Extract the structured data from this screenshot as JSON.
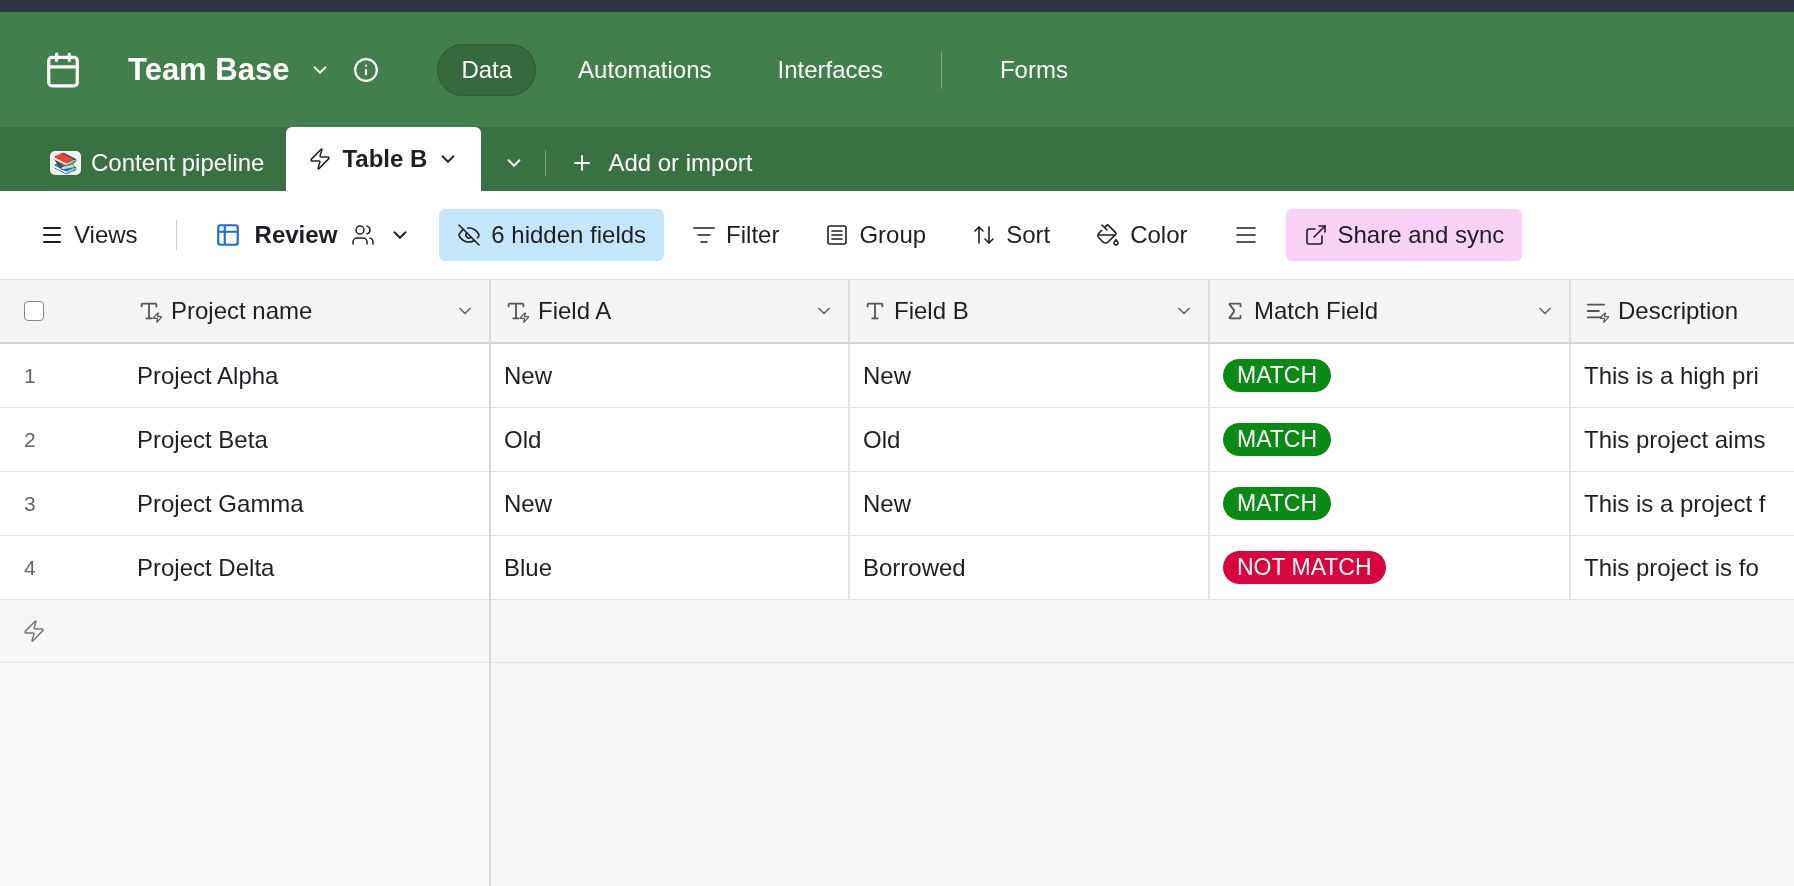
{
  "base": {
    "title": "Team Base",
    "nav": [
      {
        "label": "Data",
        "selected": true
      },
      {
        "label": "Automations",
        "selected": false
      },
      {
        "label": "Interfaces",
        "selected": false
      },
      {
        "label": "Forms",
        "selected": false
      }
    ]
  },
  "tables": {
    "items": [
      {
        "icon": "📚",
        "label": "Content pipeline",
        "selected": false
      },
      {
        "label": "Table B",
        "selected": true
      }
    ],
    "add_label": "Add or import"
  },
  "toolbar": {
    "views_label": "Views",
    "view_name": "Review",
    "buttons": [
      {
        "kind": "hidden",
        "label": "6 hidden fields"
      },
      {
        "kind": "filter",
        "label": "Filter"
      },
      {
        "kind": "group",
        "label": "Group"
      },
      {
        "kind": "sort",
        "label": "Sort"
      },
      {
        "kind": "color",
        "label": "Color"
      },
      {
        "kind": "row-height"
      },
      {
        "kind": "share",
        "label": "Share and sync"
      }
    ]
  },
  "table": {
    "select_all": {
      "checked": false
    },
    "columns": [
      {
        "name": "Project name",
        "kind": "text-ai"
      },
      {
        "name": "Field A",
        "kind": "text-ai"
      },
      {
        "name": "Field B",
        "kind": "text"
      },
      {
        "name": "Match Field",
        "kind": "formula"
      },
      {
        "name": "Description",
        "kind": "long-text-ai"
      }
    ],
    "rows": [
      {
        "number": "1",
        "name": "Project Alpha",
        "field_a": "New",
        "field_b": "New",
        "match": {
          "label": "MATCH",
          "color": "#0a8a12"
        },
        "description": "This is a high pri"
      },
      {
        "number": "2",
        "name": "Project Beta",
        "field_a": "Old",
        "field_b": "Old",
        "match": {
          "label": "MATCH",
          "color": "#0a8a12"
        },
        "description": "This project aims"
      },
      {
        "number": "3",
        "name": "Project Gamma",
        "field_a": "New",
        "field_b": "New",
        "match": {
          "label": "MATCH",
          "color": "#0a8a12"
        },
        "description": "This is a project f"
      },
      {
        "number": "4",
        "name": "Project Delta",
        "field_a": "Blue",
        "field_b": "Borrowed",
        "match": {
          "label": "NOT MATCH",
          "color": "#d9043d"
        },
        "description": "This project is fo"
      }
    ]
  }
}
